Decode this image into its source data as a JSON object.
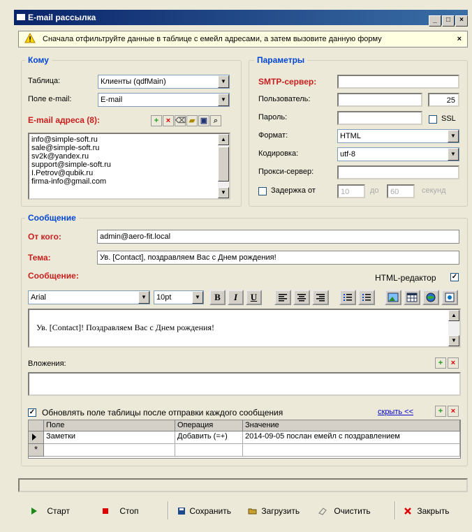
{
  "window": {
    "title": "E-mail рассылка",
    "buttons": [
      "_",
      "□",
      "×"
    ]
  },
  "notice": {
    "text": "Сначала отфильтруйте данные в таблице с емейл адресами, а затем вызовите данную форму",
    "close": "×"
  },
  "komu": {
    "legend": "Кому",
    "table_label": "Таблица:",
    "table_value": "Клиенты (qdfMain)",
    "field_label": "Поле e-mail:",
    "field_value": "E-mail",
    "emails_label": "E-mail адреса (8):",
    "emails": [
      "info@simple-soft.ru",
      "sale@simple-soft.ru",
      "sv2k@yandex.ru",
      "support@simple-soft.ru",
      "I.Petrov@qubik.ru",
      "firma-info@gmail.com"
    ]
  },
  "params": {
    "legend": "Параметры",
    "smtp_label": "SMTP-сервер:",
    "smtp_value": "",
    "user_label": "Пользователь:",
    "user_value": "",
    "port_value": "25",
    "password_label": "Пароль:",
    "password_value": "",
    "ssl_label": "SSL",
    "format_label": "Формат:",
    "format_value": "HTML",
    "encoding_label": "Кодировка:",
    "encoding_value": "utf-8",
    "proxy_label": "Прокси-сервер:",
    "proxy_value": "",
    "delay_label": "Задержка от",
    "delay_from": "10",
    "delay_to_label": "до",
    "delay_to": "60",
    "delay_unit": "секунд"
  },
  "message": {
    "legend": "Сообщение",
    "from_label": "От кого:",
    "from_value": "admin@aero-fit.local",
    "subject_label": "Тема:",
    "subject_value": "Ув. [Contact], поздравляем Вас с Днем рождения!",
    "body_label": "Сообщение:",
    "html_editor_label": "HTML-редактор",
    "font_value": "Arial",
    "size_value": "10pt",
    "bold": "B",
    "italic": "I",
    "underline": "U",
    "body_text": "Ув. [Contact]! Поздравляем Вас с Днем рождения!",
    "attachments_label": "Вложения:",
    "update_label": "Обновлять поле таблицы после отправки каждого сообщения",
    "hide_link": "скрыть <<",
    "grid": {
      "headers": [
        "Поле",
        "Операция",
        "Значение"
      ],
      "rows": [
        [
          "Заметки",
          "Добавить (=+)",
          "2014-09-05 послан емейл с поздравлением"
        ]
      ],
      "new_row_marker": "*"
    }
  },
  "footer": {
    "start": "Старт",
    "stop": "Стоп",
    "save": "Сохранить",
    "load": "Загрузить",
    "clear": "Очистить",
    "close": "Закрыть"
  }
}
